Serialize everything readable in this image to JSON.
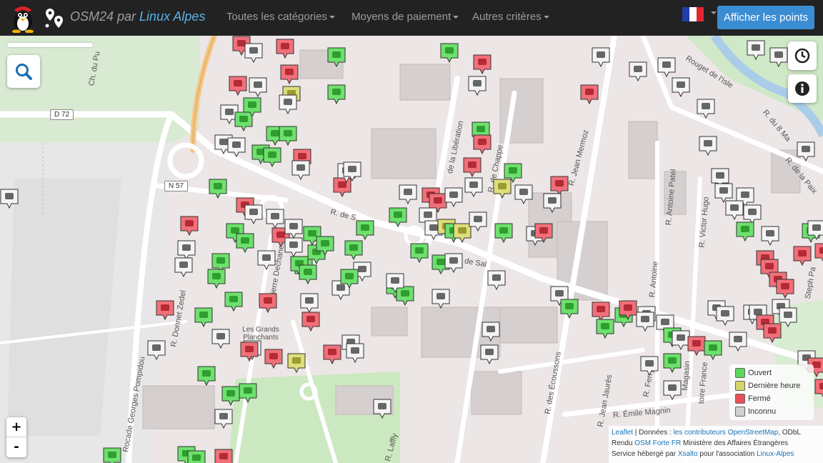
{
  "navbar": {
    "brand_prefix": "OSM24 par ",
    "brand_link": "Linux Alpes",
    "menus": [
      "Toutes les catégories",
      "Moyens de paiement",
      "Autres critères"
    ],
    "show_points_button": "Afficher les points",
    "language_flag": "flag-fr-icon"
  },
  "map": {
    "streets": [
      "Ch. du Pu",
      "D 72",
      "N 57",
      "R. de S",
      "de la Libération",
      "R. de Chappe",
      "R. Jean Mermoz",
      "Rouget de l'Isle",
      "R. du 8 Ma",
      "R. de la Paix",
      "R. Antoine Patel",
      "R. Victor Hugo",
      "R. Donnet Zedel",
      "R. Pierre Dechanet",
      "Les Grands Planchants",
      "Rocade Georges Pompidou",
      "de Sal",
      "R. des Écoussons",
      "R. Jean Jaurès",
      "R. Émile Magnin",
      "R. Antoine",
      "R. Laffly",
      "R. Ferry",
      "Magasin",
      "toire France",
      "Steph Pa"
    ],
    "legend": [
      {
        "label": "Ouvert",
        "color": "#5cd65c"
      },
      {
        "label": "Dernière heure",
        "color": "#d4d46a"
      },
      {
        "label": "Fermé",
        "color": "#e8505a"
      },
      {
        "label": "Inconnu",
        "color": "#d0d0d0"
      }
    ],
    "zoom_in": "+",
    "zoom_out": "-",
    "search_icon": "search-icon",
    "history_icon": "clock-icon",
    "info_icon": "info-icon"
  },
  "attribution": {
    "leaflet": "Leaflet",
    "data_prefix": " | Données : ",
    "contributors": "les contributeurs OpenStreetMap",
    "license": ", ODbL",
    "render_prefix": "Rendu ",
    "render_link": "OSM Forte FR",
    "render_suffix": " Ministère des Affaires Étrangères",
    "service_prefix": "Service hébergé par ",
    "service_link": "Xsalto",
    "service_mid": " pour l'association ",
    "service_link2": "Linux-Alpes"
  }
}
